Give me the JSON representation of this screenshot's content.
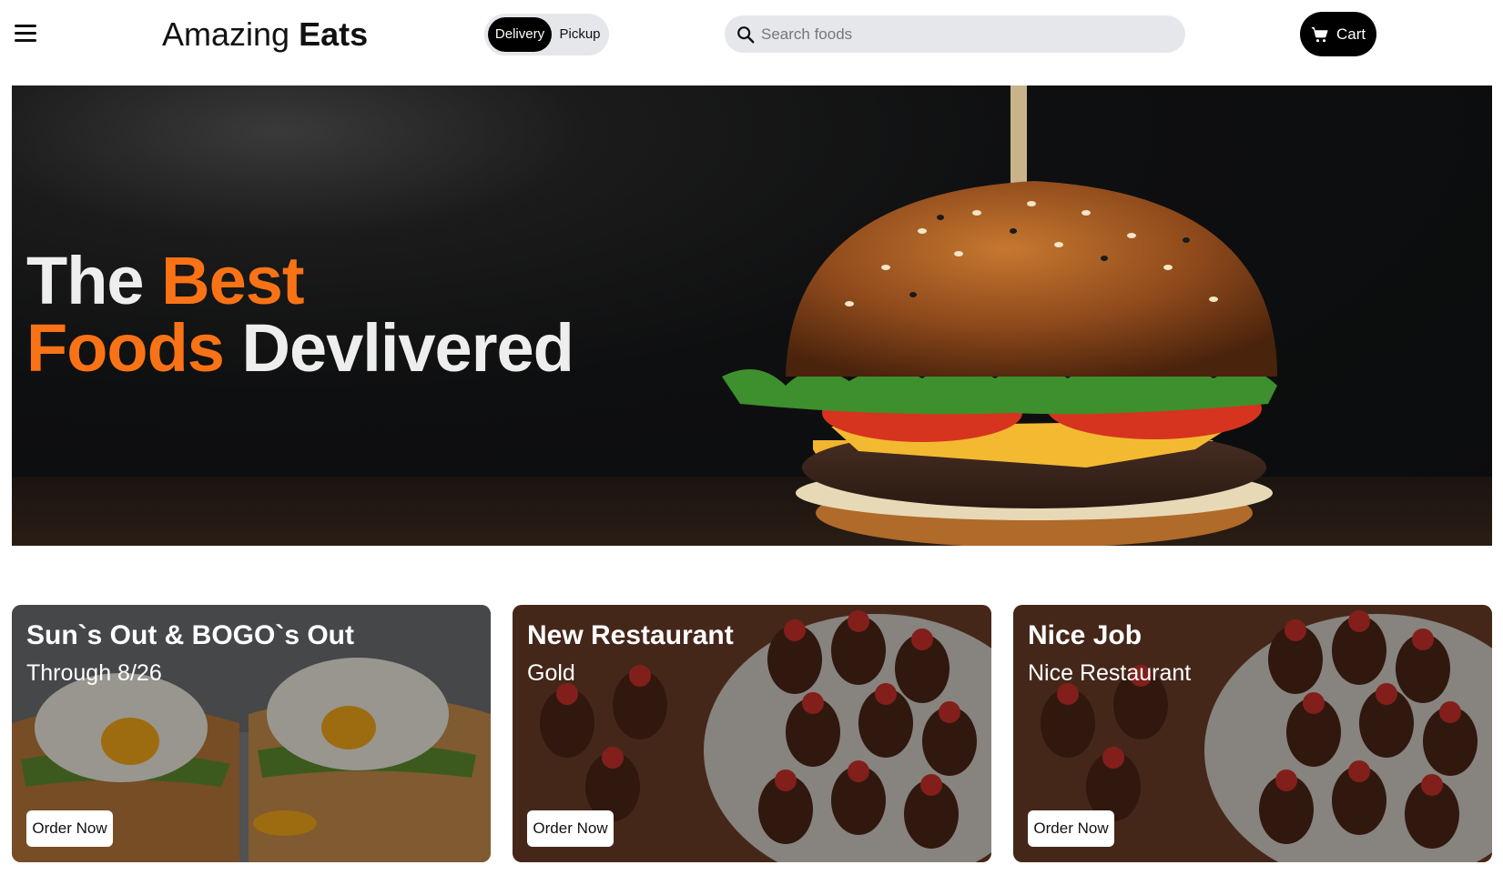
{
  "header": {
    "logo_regular": "Amazing",
    "logo_bold": "Eats",
    "toggle": {
      "delivery": "Delivery",
      "pickup": "Pickup",
      "selected": "Delivery"
    },
    "search_placeholder": "Search foods",
    "cart_label": "Cart"
  },
  "hero": {
    "line1_white": "The",
    "line1_accent": "Best",
    "line2_accent": "Foods",
    "line2_white": "Devlivered",
    "accent_color": "#f97316",
    "image": "burger"
  },
  "cards": [
    {
      "title": "Sun`s Out & BOGO`s Out",
      "subtitle": "Through 8/26",
      "button": "Order Now",
      "image": "avocado-toast-eggs"
    },
    {
      "title": "New Restaurant",
      "subtitle": "Gold",
      "button": "Order Now",
      "image": "chocolate-strawberries"
    },
    {
      "title": "Nice Job",
      "subtitle": "Nice Restaurant",
      "button": "Order Now",
      "image": "chocolate-strawberries"
    }
  ]
}
